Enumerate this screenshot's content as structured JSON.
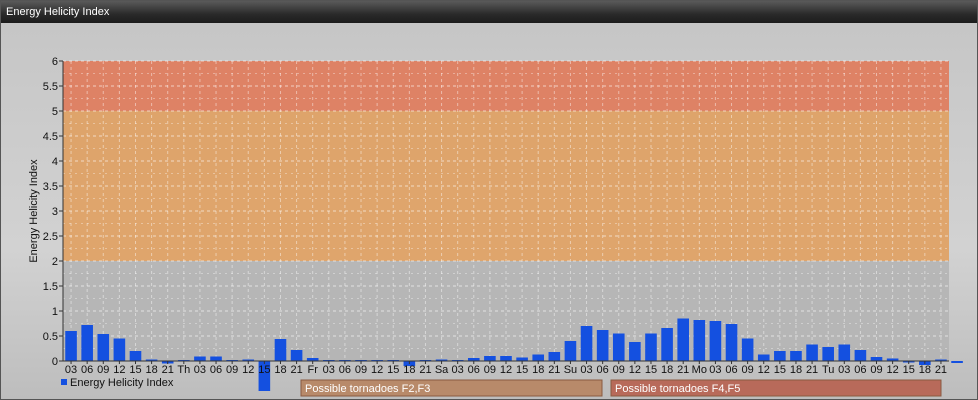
{
  "window": {
    "title": "Energy Helicity Index"
  },
  "colors": {
    "bar": "#1450e0",
    "band_low": "#b4b4b4",
    "band_mid": "#e0a060",
    "band_high": "#e07a5a",
    "tornado_f2f3": "#b88a6a",
    "tornado_f4f5": "#b86a5a"
  },
  "tornado_labels": {
    "f2f3": "Possible tornadoes F2,F3",
    "f4f5": "Possible tornadoes F4,F5"
  },
  "chart_data": {
    "type": "bar",
    "title": "",
    "xlabel": "",
    "ylabel": "Energy Helicity Index",
    "ylim": [
      0,
      6
    ],
    "yticks": [
      "0",
      "0.5",
      "1",
      "1.5",
      "2",
      "2.5",
      "3",
      "3.5",
      "4",
      "4.5",
      "5",
      "5.5",
      "6"
    ],
    "grid": true,
    "legend": "bottom-left",
    "bands": [
      {
        "from": 0,
        "to": 2,
        "color": "#b4b4b4"
      },
      {
        "from": 2,
        "to": 5,
        "color": "#e0a060"
      },
      {
        "from": 5,
        "to": 6,
        "color": "#e07a5a"
      }
    ],
    "categories": [
      "03",
      "06",
      "09",
      "12",
      "15",
      "18",
      "21",
      "Th",
      "03",
      "06",
      "09",
      "12",
      "15",
      "18",
      "21",
      "Fr",
      "03",
      "06",
      "09",
      "12",
      "15",
      "18",
      "21",
      "Sa",
      "03",
      "06",
      "09",
      "12",
      "15",
      "18",
      "21",
      "Su",
      "03",
      "06",
      "09",
      "12",
      "15",
      "18",
      "21",
      "Mo",
      "03",
      "06",
      "09",
      "12",
      "15",
      "18",
      "21",
      "Tu",
      "03",
      "06",
      "09",
      "12",
      "15",
      "18",
      "21"
    ],
    "series": [
      {
        "name": "Energy Helicity Index",
        "values": [
          0.6,
          0.72,
          0.54,
          0.45,
          0.2,
          0.03,
          -0.05,
          0.02,
          0.09,
          0.09,
          0.02,
          0.03,
          -0.6,
          0.44,
          0.22,
          0.06,
          0.02,
          0.02,
          0.02,
          0.02,
          0.02,
          -0.1,
          0.02,
          0.03,
          0.02,
          0.06,
          0.1,
          0.1,
          0.07,
          0.13,
          0.18,
          0.4,
          0.7,
          0.62,
          0.55,
          0.38,
          0.55,
          0.66,
          0.85,
          0.82,
          0.8,
          0.74,
          0.45,
          0.13,
          0.2,
          0.2,
          0.33,
          0.28,
          0.33,
          0.22,
          0.08,
          0.05,
          -0.03,
          -0.08,
          0.03,
          -0.04
        ]
      }
    ]
  }
}
